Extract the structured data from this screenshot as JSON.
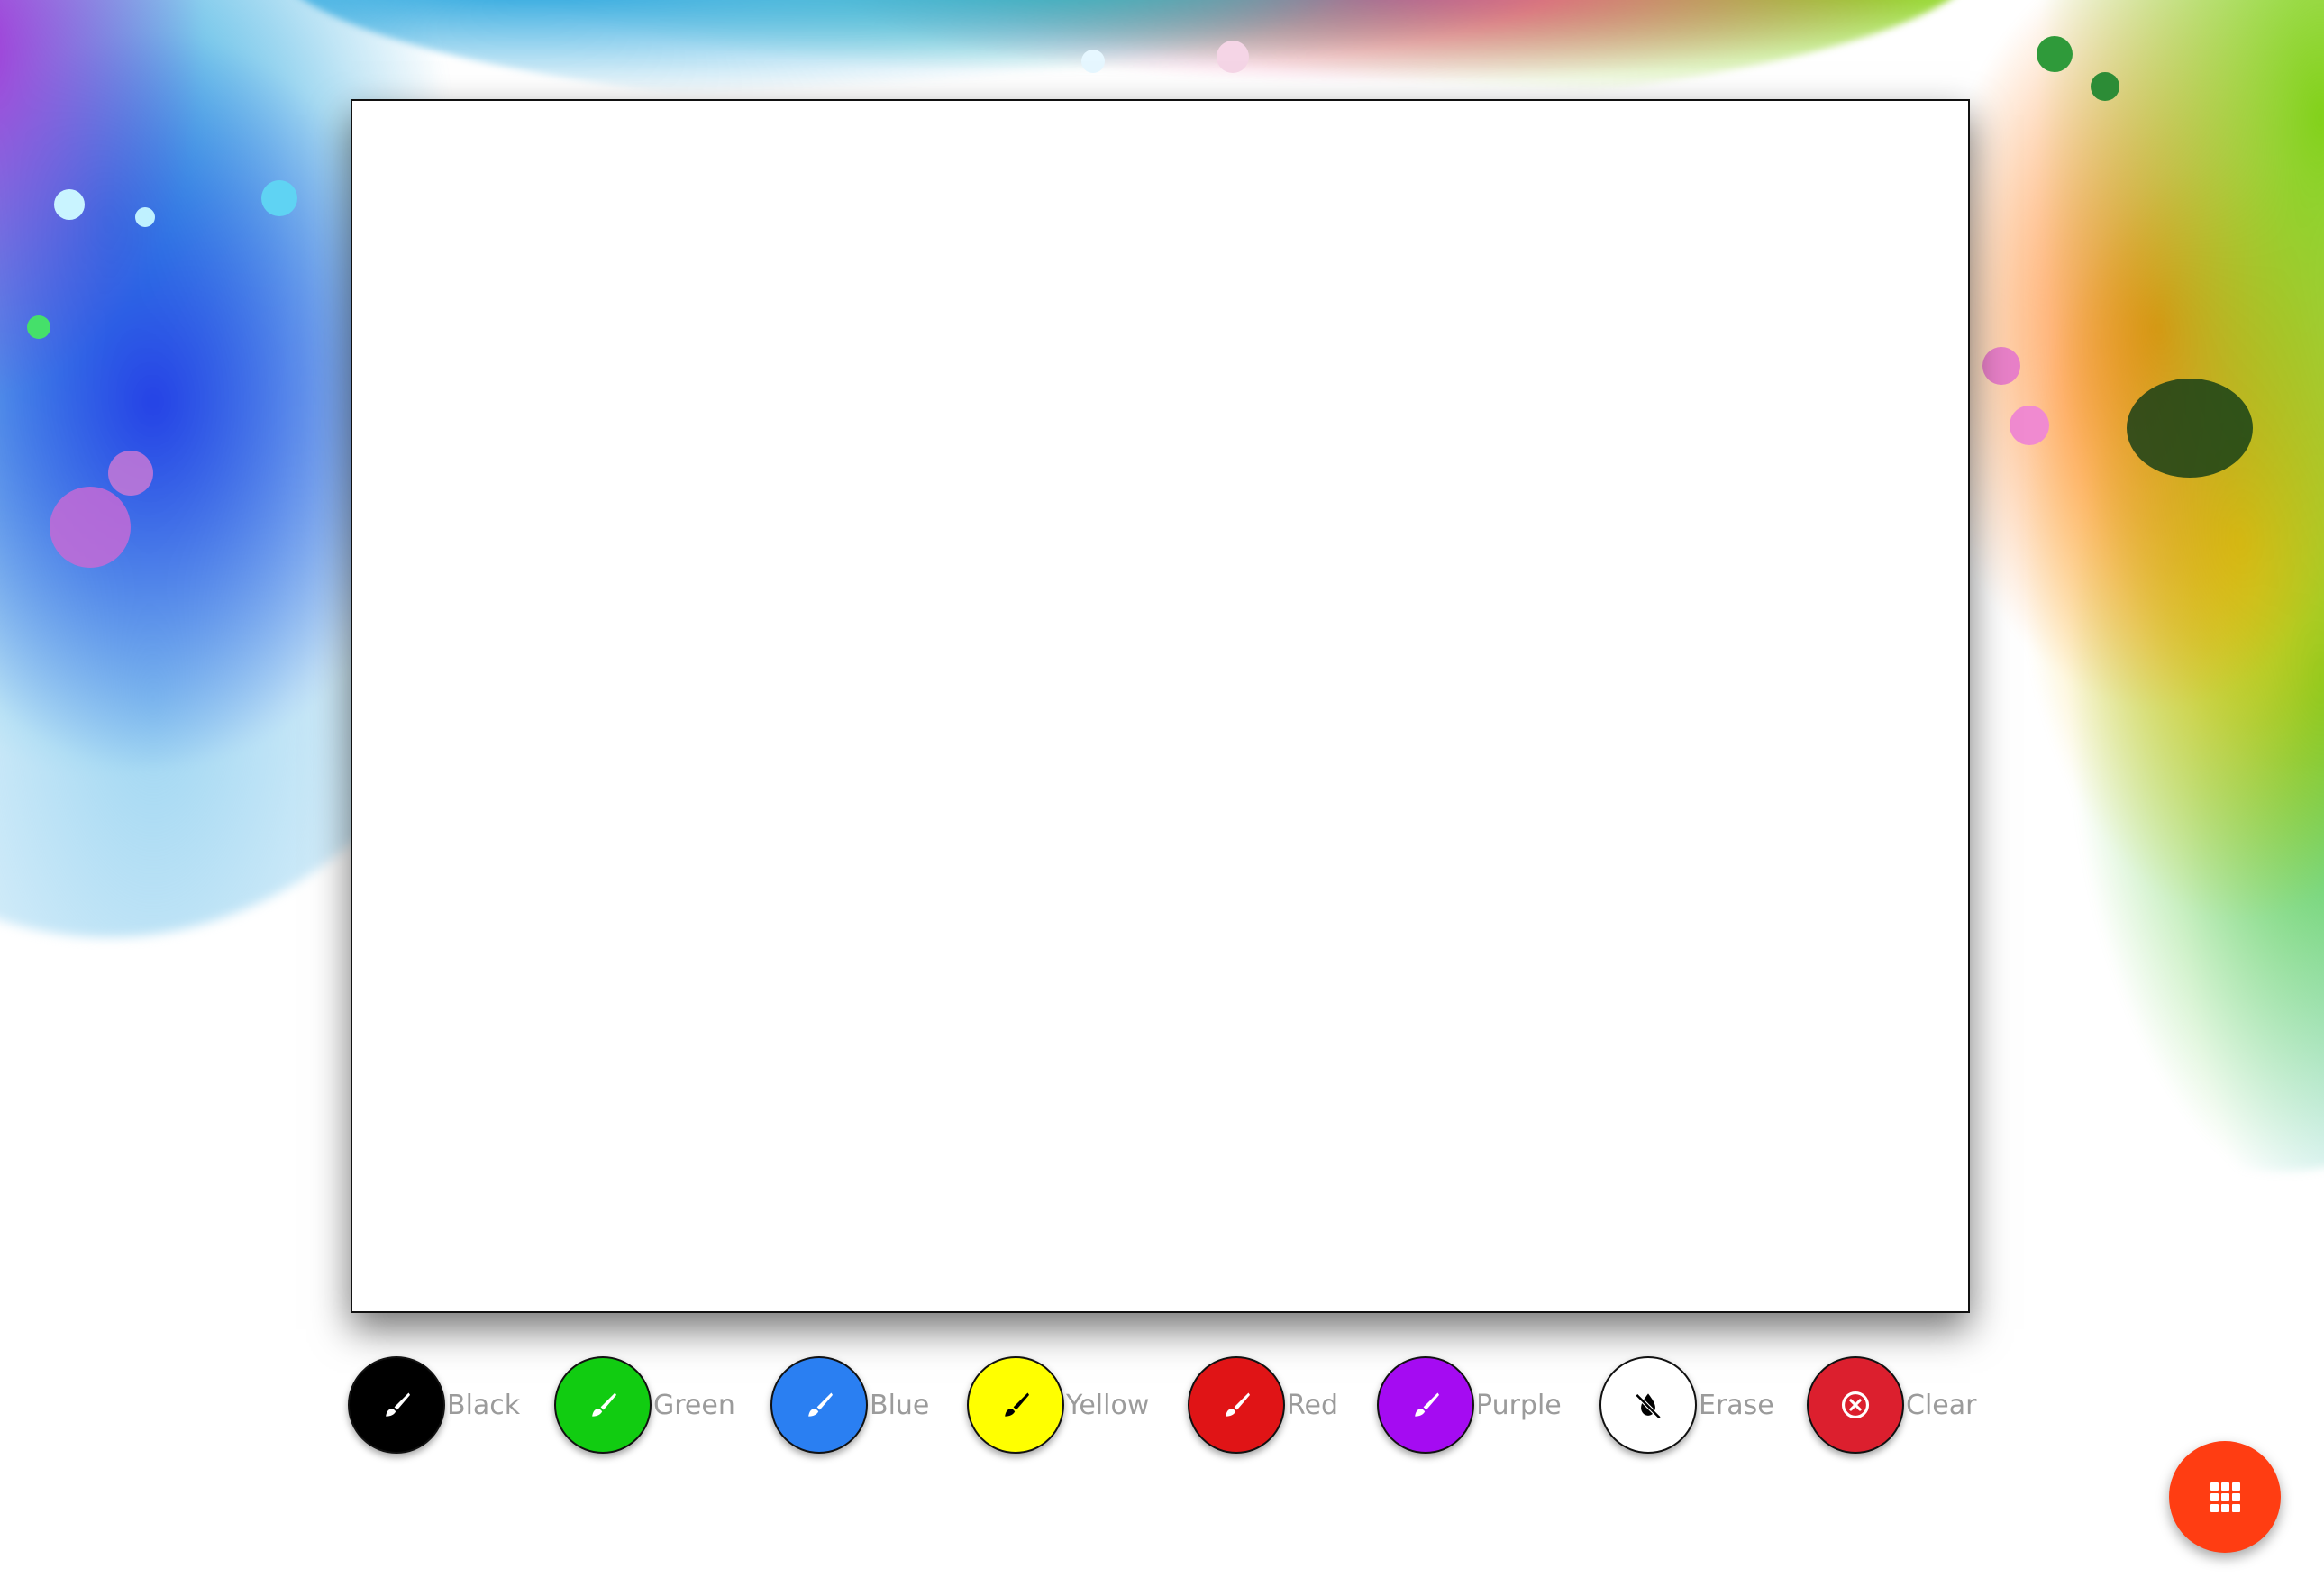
{
  "canvas": {
    "state": "blank"
  },
  "tools": [
    {
      "id": "black",
      "label": "Black",
      "color": "#000000",
      "icon": "brush-icon",
      "icon_color": "#ffffff"
    },
    {
      "id": "green",
      "label": "Green",
      "color": "#11cc11",
      "icon": "brush-icon",
      "icon_color": "#ffffff"
    },
    {
      "id": "blue",
      "label": "Blue",
      "color": "#2a7ff2",
      "icon": "brush-icon",
      "icon_color": "#ffffff"
    },
    {
      "id": "yellow",
      "label": "Yellow",
      "color": "#ffff00",
      "icon": "brush-icon",
      "icon_color": "#000000"
    },
    {
      "id": "red",
      "label": "Red",
      "color": "#e01416",
      "icon": "brush-icon",
      "icon_color": "#ffffff"
    },
    {
      "id": "purple",
      "label": "Purple",
      "color": "#a50bf2",
      "icon": "brush-icon",
      "icon_color": "#ffffff"
    },
    {
      "id": "erase",
      "label": "Erase",
      "color": "#ffffff",
      "icon": "eraser-icon",
      "icon_color": "#000000"
    },
    {
      "id": "clear",
      "label": "Clear",
      "color": "#dc1f2e",
      "icon": "clear-circle-x-icon",
      "icon_color": "#ffffff"
    }
  ],
  "fab": {
    "icon": "apps-grid-icon",
    "color": "#ff3d12"
  }
}
